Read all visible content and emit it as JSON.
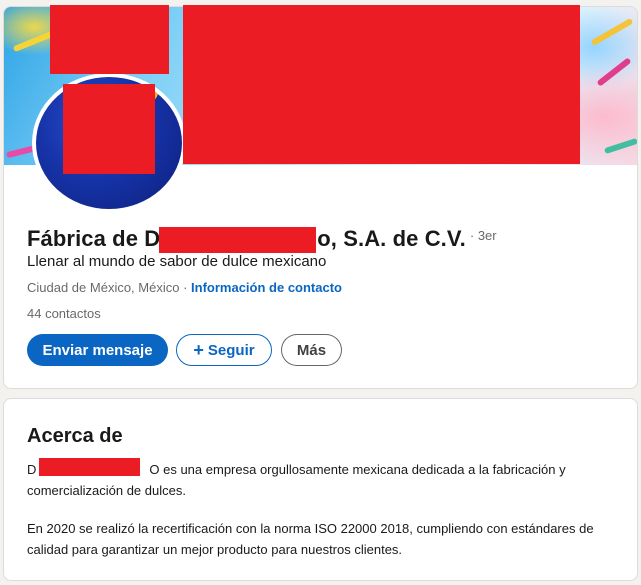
{
  "profile": {
    "name_start": "Fábrica de D",
    "name_end": "o, S.A. de C.V.",
    "degree": "· 3er",
    "headline": "Llenar al mundo de sabor de dulce mexicano",
    "location": "Ciudad de México, México",
    "separator": " · ",
    "contact_link": "Información de contacto",
    "connections": "44 contactos",
    "buttons": {
      "message": "Enviar mensaje",
      "follow": "Seguir",
      "more": "Más"
    },
    "icons": {
      "follow": "plus-icon"
    }
  },
  "about": {
    "title": "Acerca de",
    "paragraph1_start": "D",
    "paragraph1_rest": "O es una empresa orgullosamente mexicana dedicada a la fabricación y comercialización de dulces.",
    "paragraph2": "En 2020 se realizó la recertificación con la norma ISO 22000 2018, cumpliendo con estándares de calidad para garantizar un mejor producto para nuestros clientes."
  },
  "colors": {
    "accent": "#0a66c2",
    "redaction": "#ec1c24",
    "page_background": "#f4f2ee"
  }
}
